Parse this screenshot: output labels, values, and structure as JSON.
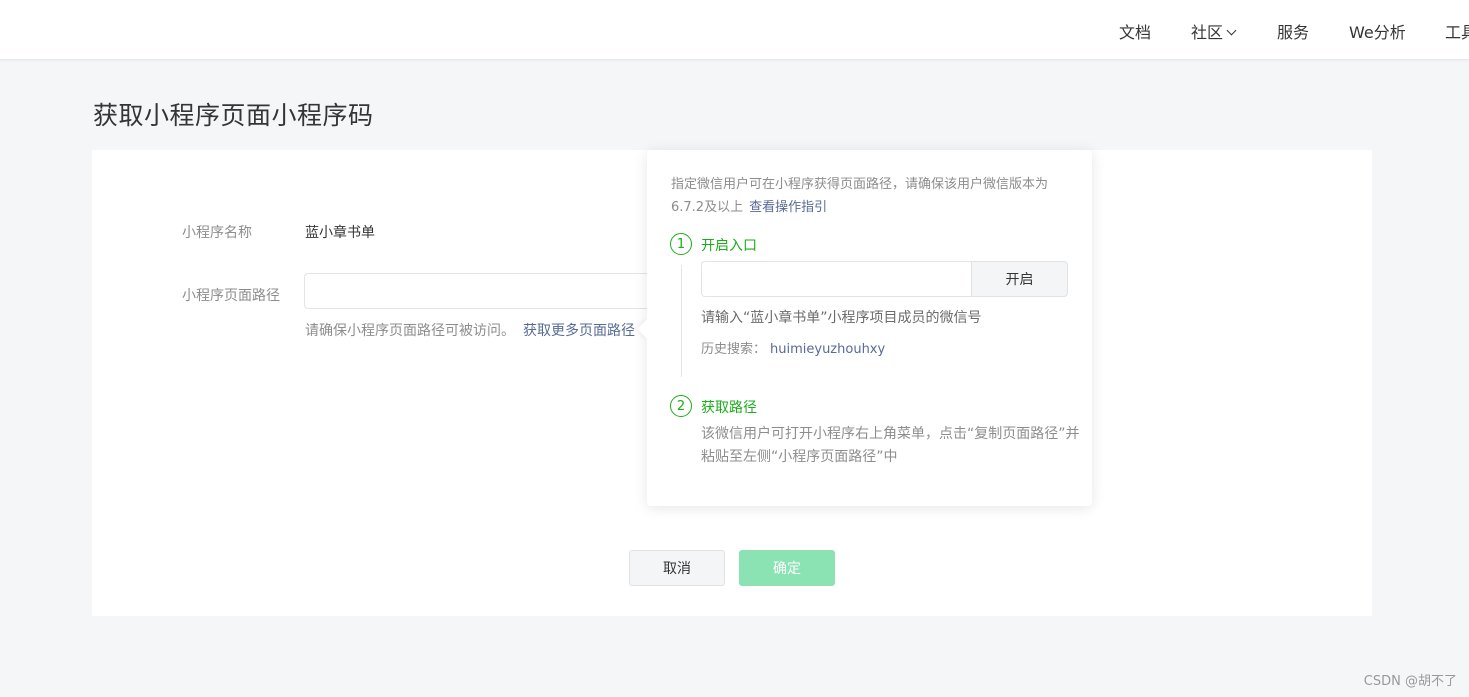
{
  "nav": {
    "items": [
      "文档",
      "社区",
      "服务",
      "We分析",
      "工具"
    ]
  },
  "page": {
    "title": "获取小程序页面小程序码"
  },
  "form": {
    "name_label": "小程序名称",
    "name_value": "蓝小章书单",
    "path_label": "小程序页面路径",
    "path_value": "",
    "path_placeholder": "",
    "hint_text": "请确保小程序页面路径可被访问。",
    "hint_link": "获取更多页面路径",
    "cancel_label": "取消",
    "ok_label": "确定"
  },
  "popover": {
    "description": "指定微信用户可在小程序获得页面路径，请确保该用户微信版本为6.7.2及以上",
    "guide_link": "查看操作指引",
    "step1": {
      "number": "1",
      "title": "开启入口",
      "input_value": "",
      "input_placeholder": "",
      "button_label": "开启",
      "tip": "请输入“蓝小章书单”小程序项目成员的微信号",
      "history_label": "历史搜索：",
      "history_value": "huimieyuzhouhxy"
    },
    "step2": {
      "number": "2",
      "title": "获取路径",
      "description": "该微信用户可打开小程序右上角菜单，点击“复制页面路径”并粘贴至左侧“小程序页面路径”中"
    }
  },
  "watermark": "CSDN @胡不了",
  "colors": {
    "accent_green": "#1aad19",
    "link_blue": "#576b95",
    "ok_button_disabled": "#8be3b4"
  },
  "icons": {
    "community_dropdown": "chevron-down-icon"
  }
}
